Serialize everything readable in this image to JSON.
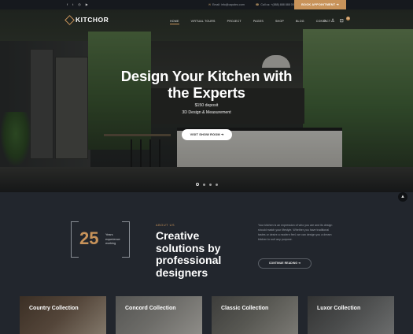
{
  "topbar": {
    "social_icons": [
      "facebook-icon",
      "twitter-icon",
      "instagram-icon",
      "youtube-icon"
    ],
    "social_glyphs": [
      "f",
      "t",
      "◎",
      "▶"
    ],
    "email": "Email: info@capaleo.com",
    "phone": "Call us: +(888) 888 888 00",
    "appointment_label": "BOOK APPOINTMENT ➔"
  },
  "nav": {
    "logo_text": "KITCHOR",
    "menu": [
      "HOME",
      "VIRTUAL TOURS",
      "PROJECT",
      "PAGES",
      "SHOP",
      "BLOG",
      "CONTACT"
    ],
    "active_item": "HOME",
    "cart_count": "0"
  },
  "hero": {
    "title": "Design Your Kitchen with the Experts",
    "line1": "$150 deposit",
    "line2": "3D Design & Measurement",
    "button_label": "VISIT SHOW ROOM ➔",
    "slides": 4,
    "active_slide": 1
  },
  "about": {
    "years_number": "25",
    "years_label": "Years experience working",
    "eyebrow": "ABOUT US",
    "title": "Creative solutions by professional designers",
    "description": "Your kitchen is an expression of who you are and its design should match your lifestyle. Whether you have traditional tastes or desire a modern feel, we can design you a dream kitchen to suit any purpose.",
    "button_label": "CONTINUE READING ➔"
  },
  "collections": [
    {
      "label": "Country Collection"
    },
    {
      "label": "Concord Collection"
    },
    {
      "label": "Classic Collection"
    },
    {
      "label": "Luxor Collection"
    }
  ],
  "colors": {
    "accent": "#c8935a",
    "background": "#22262d",
    "topbar": "#16191e"
  }
}
